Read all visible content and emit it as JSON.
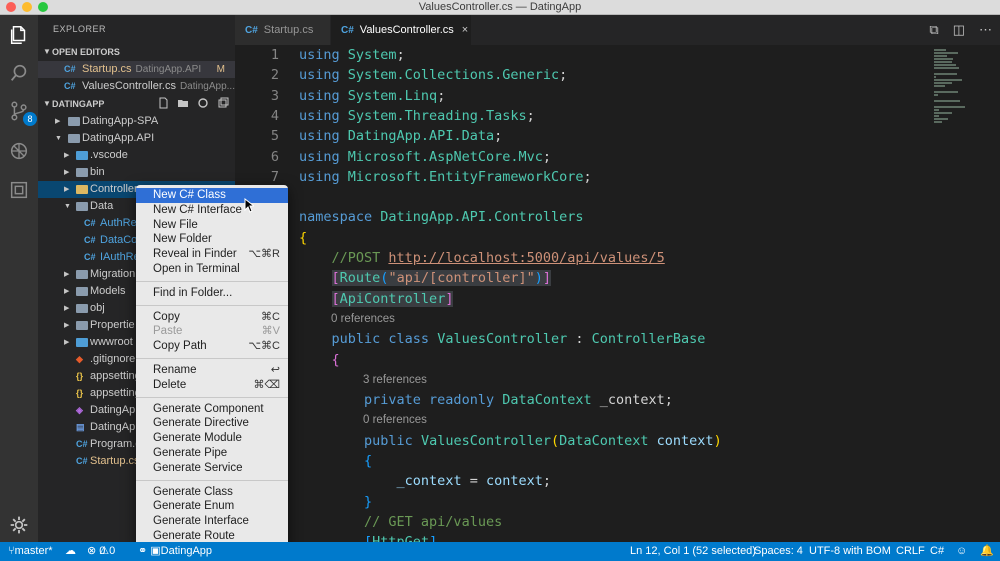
{
  "window": {
    "title": "ValuesController.cs — DatingApp"
  },
  "activity_bar": {
    "scm_badge": "8"
  },
  "sidebar": {
    "header": "EXPLORER",
    "open_editors": {
      "label": "OPEN EDITORS",
      "items": [
        {
          "name": "Startup.cs",
          "desc": "DatingApp.API",
          "status": "M"
        },
        {
          "name": "ValuesController.cs",
          "desc": "DatingApp..."
        }
      ]
    },
    "project": {
      "label": "DATINGAPP",
      "tree": [
        {
          "name": "DatingApp-SPA",
          "kind": "folder"
        },
        {
          "name": "DatingApp.API",
          "kind": "folder"
        },
        {
          "name": ".vscode",
          "kind": "folder"
        },
        {
          "name": "bin",
          "kind": "folder"
        },
        {
          "name": "Controllers",
          "kind": "folder"
        },
        {
          "name": "Data",
          "kind": "folder"
        },
        {
          "name": "AuthRe",
          "kind": "file"
        },
        {
          "name": "DataCo",
          "kind": "file"
        },
        {
          "name": "IAuthRe",
          "kind": "file"
        },
        {
          "name": "Migration",
          "kind": "folder"
        },
        {
          "name": "Models",
          "kind": "folder"
        },
        {
          "name": "obj",
          "kind": "folder"
        },
        {
          "name": "Propertie",
          "kind": "folder"
        },
        {
          "name": "wwwroot",
          "kind": "folder"
        },
        {
          "name": ".gitignore",
          "kind": "file"
        },
        {
          "name": "appsetting",
          "kind": "file"
        },
        {
          "name": "appsetting",
          "kind": "file"
        },
        {
          "name": "DatingAp",
          "kind": "file"
        },
        {
          "name": "DatingAp",
          "kind": "file"
        },
        {
          "name": "Program.c",
          "kind": "file"
        },
        {
          "name": "Startup.cs",
          "kind": "file"
        }
      ]
    }
  },
  "tabs": [
    {
      "label": "Startup.cs",
      "icon": "C#"
    },
    {
      "label": "ValuesController.cs",
      "icon": "C#",
      "close": "×"
    }
  ],
  "editor": {
    "lines": [
      {
        "n": "1",
        "t": [
          [
            "kw",
            "using "
          ],
          [
            "ty",
            "System"
          ],
          [
            "pl",
            ";"
          ]
        ]
      },
      {
        "n": "2",
        "t": [
          [
            "kw",
            "using "
          ],
          [
            "ty",
            "System.Collections.Generic"
          ],
          [
            "pl",
            ";"
          ]
        ]
      },
      {
        "n": "3",
        "t": [
          [
            "kw",
            "using "
          ],
          [
            "ty",
            "System.Linq"
          ],
          [
            "pl",
            ";"
          ]
        ]
      },
      {
        "n": "4",
        "t": [
          [
            "kw",
            "using "
          ],
          [
            "ty",
            "System.Threading.Tasks"
          ],
          [
            "pl",
            ";"
          ]
        ]
      },
      {
        "n": "5",
        "t": [
          [
            "kw",
            "using "
          ],
          [
            "ty",
            "DatingApp.API.Data"
          ],
          [
            "pl",
            ";"
          ]
        ]
      },
      {
        "n": "6",
        "t": [
          [
            "kw",
            "using "
          ],
          [
            "ty",
            "Microsoft.AspNetCore.Mvc"
          ],
          [
            "pl",
            ";"
          ]
        ]
      },
      {
        "n": "7",
        "t": [
          [
            "kw",
            "using "
          ],
          [
            "ty",
            "Microsoft.EntityFrameworkCore"
          ],
          [
            "pl",
            ";"
          ]
        ]
      },
      {
        "n": "",
        "t": []
      },
      {
        "n": "",
        "t": [
          [
            "kw",
            "namespace "
          ],
          [
            "ty",
            "DatingApp.API.Controllers"
          ]
        ]
      },
      {
        "n": "",
        "t": [
          [
            "yb",
            "{"
          ]
        ]
      },
      {
        "n": "",
        "t": [
          [
            "pl",
            "    "
          ],
          [
            "cm",
            "//POST "
          ],
          [
            "link",
            "http://localhost:5000/api/values/5"
          ]
        ]
      },
      {
        "n": "",
        "t": [
          [
            "pl",
            "    "
          ],
          [
            "pb",
            "["
          ],
          [
            "ty",
            "Route"
          ],
          [
            "bb",
            "("
          ],
          [
            "st",
            "\"api/[controller]\""
          ],
          [
            "bb",
            ")"
          ],
          [
            "pb",
            "]"
          ]
        ]
      },
      {
        "n": "",
        "t": [
          [
            "pl",
            "    "
          ],
          [
            "pb",
            "["
          ],
          [
            "ty",
            "ApiController"
          ],
          [
            "pb",
            "]"
          ]
        ]
      },
      {
        "n": "",
        "lens": "0 references",
        "t": []
      },
      {
        "n": "",
        "t": [
          [
            "pl",
            "    "
          ],
          [
            "kw",
            "public class "
          ],
          [
            "ty",
            "ValuesController"
          ],
          [
            "pl",
            " : "
          ],
          [
            "ty",
            "ControllerBase"
          ]
        ]
      },
      {
        "n": "",
        "t": [
          [
            "pl",
            "    "
          ],
          [
            "pb",
            "{"
          ]
        ]
      },
      {
        "n": "",
        "lens": "3 references",
        "t": []
      },
      {
        "n": "",
        "t": [
          [
            "pl",
            "        "
          ],
          [
            "kw",
            "private readonly "
          ],
          [
            "ty",
            "DataContext"
          ],
          [
            "pl",
            " _context;"
          ]
        ]
      },
      {
        "n": "",
        "lens": "0 references",
        "t": []
      },
      {
        "n": "",
        "t": [
          [
            "pl",
            "        "
          ],
          [
            "kw",
            "public "
          ],
          [
            "ty",
            "ValuesController"
          ],
          [
            "yb",
            "("
          ],
          [
            "ty",
            "DataContext"
          ],
          [
            "id",
            " context"
          ],
          [
            "yb",
            ")"
          ]
        ]
      },
      {
        "n": "",
        "t": [
          [
            "pl",
            "        "
          ],
          [
            "bb",
            "{"
          ]
        ]
      },
      {
        "n": "",
        "t": [
          [
            "pl",
            "            "
          ],
          [
            "id",
            "_context"
          ],
          [
            "pl",
            " = "
          ],
          [
            "id",
            "context"
          ],
          [
            "pl",
            ";"
          ]
        ]
      },
      {
        "n": "",
        "t": [
          [
            "pl",
            "        "
          ],
          [
            "bb",
            "}"
          ]
        ]
      },
      {
        "n": "",
        "t": [
          [
            "pl",
            "        "
          ],
          [
            "cm",
            "// GET api/values"
          ]
        ]
      },
      {
        "n": "",
        "t": [
          [
            "pl",
            "        "
          ],
          [
            "bb",
            "["
          ],
          [
            "ty",
            "HttpGet"
          ],
          [
            "bb",
            "]"
          ]
        ]
      }
    ]
  },
  "context_menu": {
    "groups": [
      [
        {
          "label": "New C# Class",
          "highlighted": true
        },
        {
          "label": "New C# Interface"
        },
        {
          "label": "New File"
        },
        {
          "label": "New Folder"
        },
        {
          "label": "Reveal in Finder",
          "shortcut": "⌥⌘R"
        },
        {
          "label": "Open in Terminal"
        }
      ],
      [
        {
          "label": "Find in Folder..."
        }
      ],
      [
        {
          "label": "Copy",
          "shortcut": "⌘C"
        },
        {
          "label": "Paste",
          "shortcut": "⌘V",
          "disabled": true
        },
        {
          "label": "Copy Path",
          "shortcut": "⌥⌘C"
        }
      ],
      [
        {
          "label": "Rename",
          "shortcut": "↩"
        },
        {
          "label": "Delete",
          "shortcut": "⌘⌫"
        }
      ],
      [
        {
          "label": "Generate Component"
        },
        {
          "label": "Generate Directive"
        },
        {
          "label": "Generate Module"
        },
        {
          "label": "Generate Pipe"
        },
        {
          "label": "Generate Service"
        }
      ],
      [
        {
          "label": "Generate Class"
        },
        {
          "label": "Generate Enum"
        },
        {
          "label": "Generate Interface"
        },
        {
          "label": "Generate Route"
        }
      ]
    ]
  },
  "status_bar": {
    "branch": "master*",
    "errors": "0",
    "warnings": "0",
    "project": "DatingApp",
    "position": "Ln 12, Col 1 (52 selected)",
    "spaces": "Spaces: 4",
    "encoding": "UTF-8 with BOM",
    "eol": "CRLF",
    "language": "C#"
  },
  "colors": {
    "accent": "#007acc",
    "menu_highlight": "#2f6fd6"
  }
}
